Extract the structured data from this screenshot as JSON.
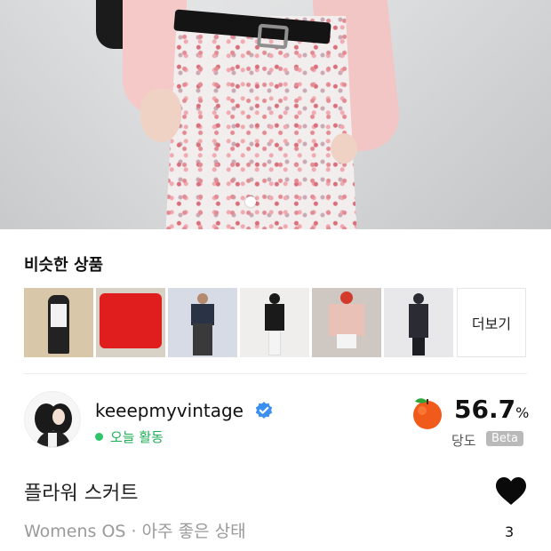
{
  "hero": {
    "image_alt": "floral skirt outfit",
    "carousel_active": 1
  },
  "similar": {
    "title": "비슷한 상품",
    "items": [
      {
        "name": "similar-item-1",
        "bg": "#d9c7a9",
        "fig": "#222222"
      },
      {
        "name": "similar-item-2",
        "bg": "#d8d2c6",
        "fig": "#e01e1e"
      },
      {
        "name": "similar-item-3",
        "bg": "#d6dbe6",
        "fig": "#2a3346"
      },
      {
        "name": "similar-item-4",
        "bg": "#f0eeec",
        "fig": "#1a1a1a"
      },
      {
        "name": "similar-item-5",
        "bg": "#cfc8c2",
        "fig": "#e9c1b7"
      },
      {
        "name": "similar-item-6",
        "bg": "#e8e8ea",
        "fig": "#2b2b33"
      }
    ],
    "more_label": "더보기"
  },
  "seller": {
    "name": "keeepmyvintage",
    "activity": "오늘 활동",
    "sweetness_value": "56.7",
    "sweetness_unit": "%",
    "sweetness_label": "당도",
    "beta_label": "Beta"
  },
  "product": {
    "title": "플라워 스커트",
    "meta": "Womens OS · 아주 좋은 상태",
    "like_count": "3"
  },
  "colors": {
    "activity_green": "#1fae57",
    "verified_blue": "#3a8ff0",
    "fruit_orange": "#f05a1a"
  }
}
